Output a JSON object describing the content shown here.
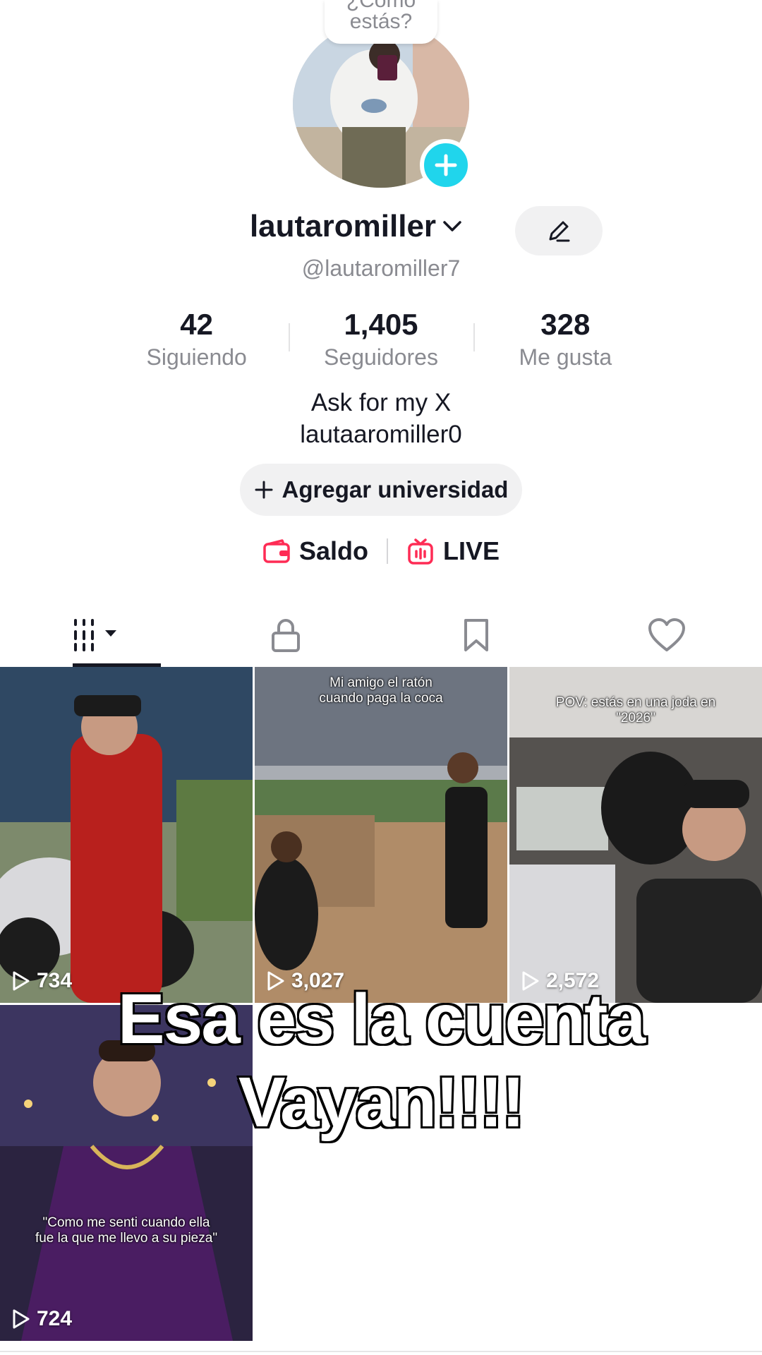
{
  "status_bubble": {
    "line1": "¿Cómo",
    "line2": "estás?"
  },
  "profile": {
    "username": "lautaromiller",
    "handle": "@lautaromiller7",
    "bio_line1": "Ask for my X",
    "bio_line2": "lautaaromiller0"
  },
  "stats": {
    "following": {
      "value": "42",
      "label": "Siguiendo"
    },
    "followers": {
      "value": "1,405",
      "label": "Seguidores"
    },
    "likes": {
      "value": "328",
      "label": "Me gusta"
    }
  },
  "add_university_label": "Agregar universidad",
  "links": {
    "balance": "Saldo",
    "live": "LIVE"
  },
  "tabs": [
    "videos",
    "private",
    "saved",
    "liked"
  ],
  "videos": [
    {
      "views": "734",
      "caption": ""
    },
    {
      "views": "3,027",
      "caption_line1": "Mi amigo el ratón",
      "caption_line2": "cuando paga la coca"
    },
    {
      "views": "2,572",
      "caption_line1": "POV: estás en una joda en",
      "caption_line2": "\"2026\""
    },
    {
      "views": "724",
      "caption_line1": "\"Como me senti cuando ella",
      "caption_line2": "fue la que me llevo a su pieza\""
    }
  ],
  "overlay": {
    "line1": "Esa es la cuenta",
    "line2": "Vayan!!!!"
  },
  "colors": {
    "accent_cyan": "#20d5ec",
    "tiktok_red": "#fe2c55",
    "text_dark": "#161823",
    "text_gray": "#8a8b91"
  }
}
